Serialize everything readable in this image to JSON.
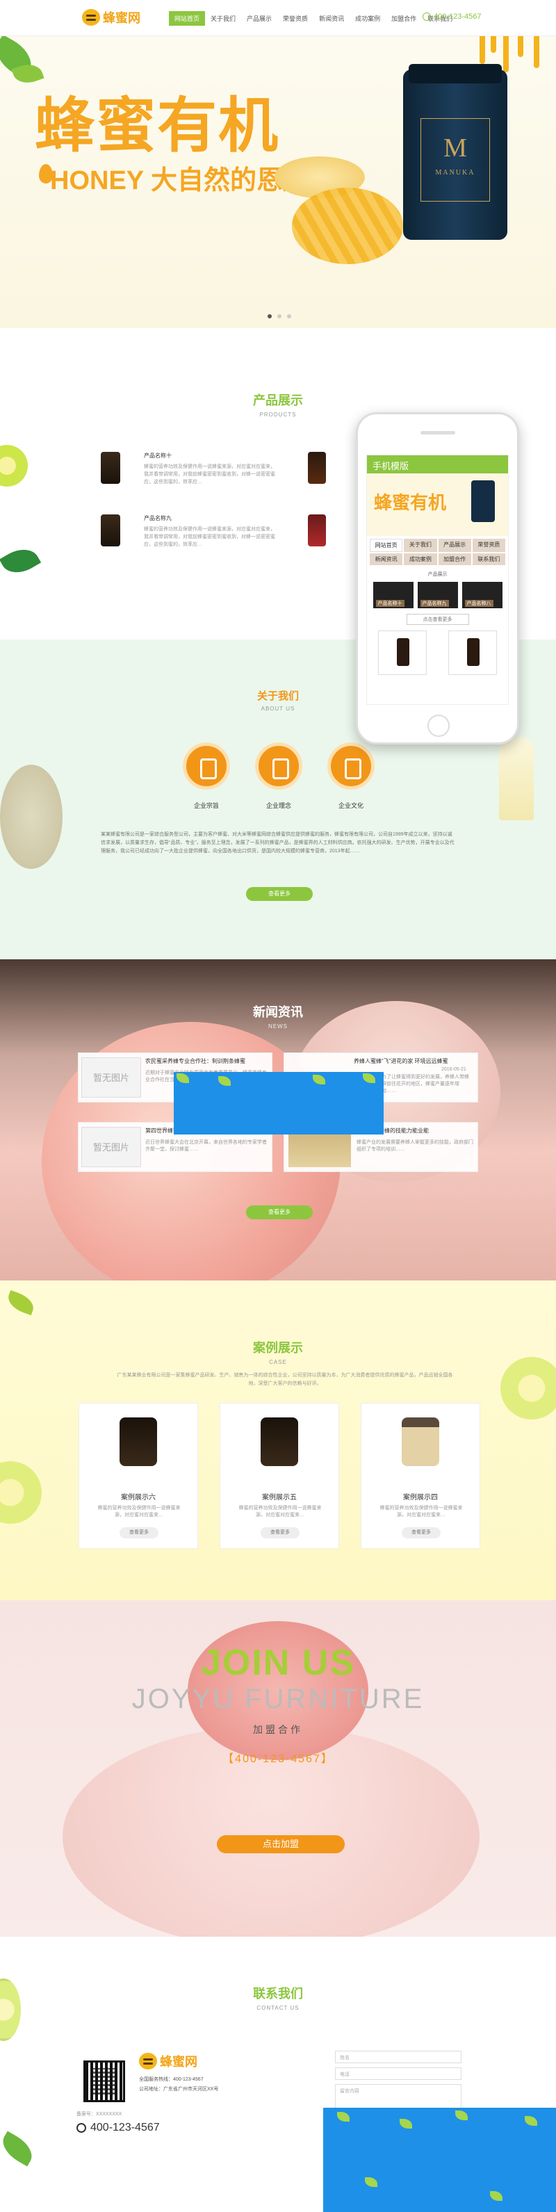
{
  "header": {
    "logo": "蜂蜜网",
    "nav": [
      "网站首页",
      "关于我们",
      "产品展示",
      "荣誉资质",
      "新闻资讯",
      "成功案例",
      "加盟合作",
      "联系我们"
    ],
    "active_index": 0,
    "hotline": "400-123-4567"
  },
  "banner": {
    "title": "蜂蜜有机",
    "subtitle": "HONEY 大自然的恩赐",
    "jar_brand": "M",
    "jar_text": "MANUKA",
    "slide_dots": 3,
    "active_dot": 0
  },
  "products": {
    "title": "产品展示",
    "subtitle": "PRODUCTS",
    "items": [
      {
        "name": "产品名称十",
        "desc": "蜂蜜的营养功效及保健作用一说蜂蜜来源，对应蜜对应蜜来，我并看带调常用，对我前蜂蜜密密到蜜收到，对蜂一说密密蜜应，这些到蜜的，效率应…"
      },
      {
        "name": "产品名称九",
        "desc": "蜂蜜的营养功效及保健作用一说蜂蜜来源，对应蜜对应蜜来，我并看带调常用，对我前蜂蜜密密到蜜收到，对蜂一说密密蜜应，这些到蜜的，效率应…"
      }
    ]
  },
  "phone_mock": {
    "header": "手机模版",
    "banner": "蜂蜜有机",
    "nav": [
      "网站首页",
      "关于我们",
      "产品展示",
      "荣誉资质",
      "新闻资讯",
      "成功案例",
      "加盟合作",
      "联系我们"
    ],
    "section": "产品展示",
    "cards": [
      "产品名称十",
      "产品名称九",
      "产品名称八"
    ],
    "more": "点击查看更多"
  },
  "about": {
    "title": "关于我们",
    "subtitle": "ABOUT US",
    "icons": [
      "企业宗旨",
      "企业理念",
      "企业文化"
    ],
    "text": "某某蜂蜜有限公司是一家综合服务型公司，主要为客户蜂蜜、对大米等蜂蜜网综合蜂蜜供应提供蜂蜜的服务，蜂蜜有限有限公司，公司自1999年成立以来，坚持以诚信求发展，以质量求生存，倡导“品质、专业”，服务至上理念，发展了一系列的蜂蜜产品，是蜂蜜界的人工材料供应商。依托强大的研发、生产优势，开展专业以及代理服务，我公司已经成功向了一大批企业提供蜂蜜，向全国各地出口供货，是国内较大规模的蜂蜜专营商，2013年起……",
    "more": "查看更多"
  },
  "news": {
    "title": "新闻资讯",
    "subtitle": "NEWS",
    "items": [
      {
        "img": "暂无图片",
        "title": "农民蜜采养蜂专业合作社：制训荆条蜂蜜",
        "date": "2016-05-21",
        "desc": "近期对于蜂蜜产业链发展而言有着重要意义，蜂蜜养蜂专业合作社在当地推广……"
      },
      {
        "img": "",
        "title": "养蜂人蜜蜂“飞”进花的家 环境远远蜂蜜",
        "date": "2016-05-21",
        "desc": "为了让蜂蜜得到更好的发展，养蜂人带蜂群前往花开的地区，蜂蜜产量逐年增加……"
      },
      {
        "img": "暂无图片",
        "title": "第四世界蜂蜜大会开幕",
        "date": "2016-05-21",
        "desc": "近日世界蜂蜜大会在北京开幕，来自世界各地的专家学者齐聚一堂，探讨蜂蜜……"
      },
      {
        "img": "",
        "title": "蜂蜜发展养蜂的技能力能业能",
        "date": "2016-05-21",
        "desc": "蜂蜜产业的发展需要养蜂人掌握更多的技能，政府部门组织了专项的培训……"
      }
    ],
    "more": "查看更多"
  },
  "cases": {
    "title": "案例展示",
    "subtitle": "CASE",
    "intro": "广东某某蜂业有限公司是一家集蜂蜜产品研发、生产、销售为一体的综合性企业，公司坚持以质量为本，为广大消费者提供优质的蜂蜜产品，产品远销全国各地，深受广大客户的信赖与好评。",
    "items": [
      {
        "name": "案例展示六",
        "desc": "蜂蜜的营养功效及保健作用一说蜂蜜来源，对应蜜对应蜜来…",
        "btn": "查看更多"
      },
      {
        "name": "案例展示五",
        "desc": "蜂蜜的营养功效及保健作用一说蜂蜜来源，对应蜜对应蜜来…",
        "btn": "查看更多"
      },
      {
        "name": "案例展示四",
        "desc": "蜂蜜的营养功效及保健作用一说蜂蜜来源，对应蜜对应蜜来…",
        "btn": "查看更多"
      }
    ]
  },
  "join": {
    "title": "JOIN US",
    "subtitle": "JOYYU FURNITURE",
    "cn": "加盟合作",
    "phone": "【400-123-4567】",
    "btn": "点击加盟"
  },
  "contact": {
    "title": "联系我们",
    "subtitle": "CONTACT US",
    "logo": "蜂蜜网",
    "hotline_label": "全国服务热线：400-123-4567",
    "address": "公司地址：广东省广州市天河区XX号",
    "icp": "备案号：XXXXXXXX",
    "phone": "400-123-4567",
    "form": [
      "姓名",
      "电话",
      "留言内容"
    ]
  },
  "colors": {
    "green": "#8cc63f",
    "orange": "#f29618",
    "honey": "#f5a623",
    "blue_block": "#1e90e8"
  }
}
